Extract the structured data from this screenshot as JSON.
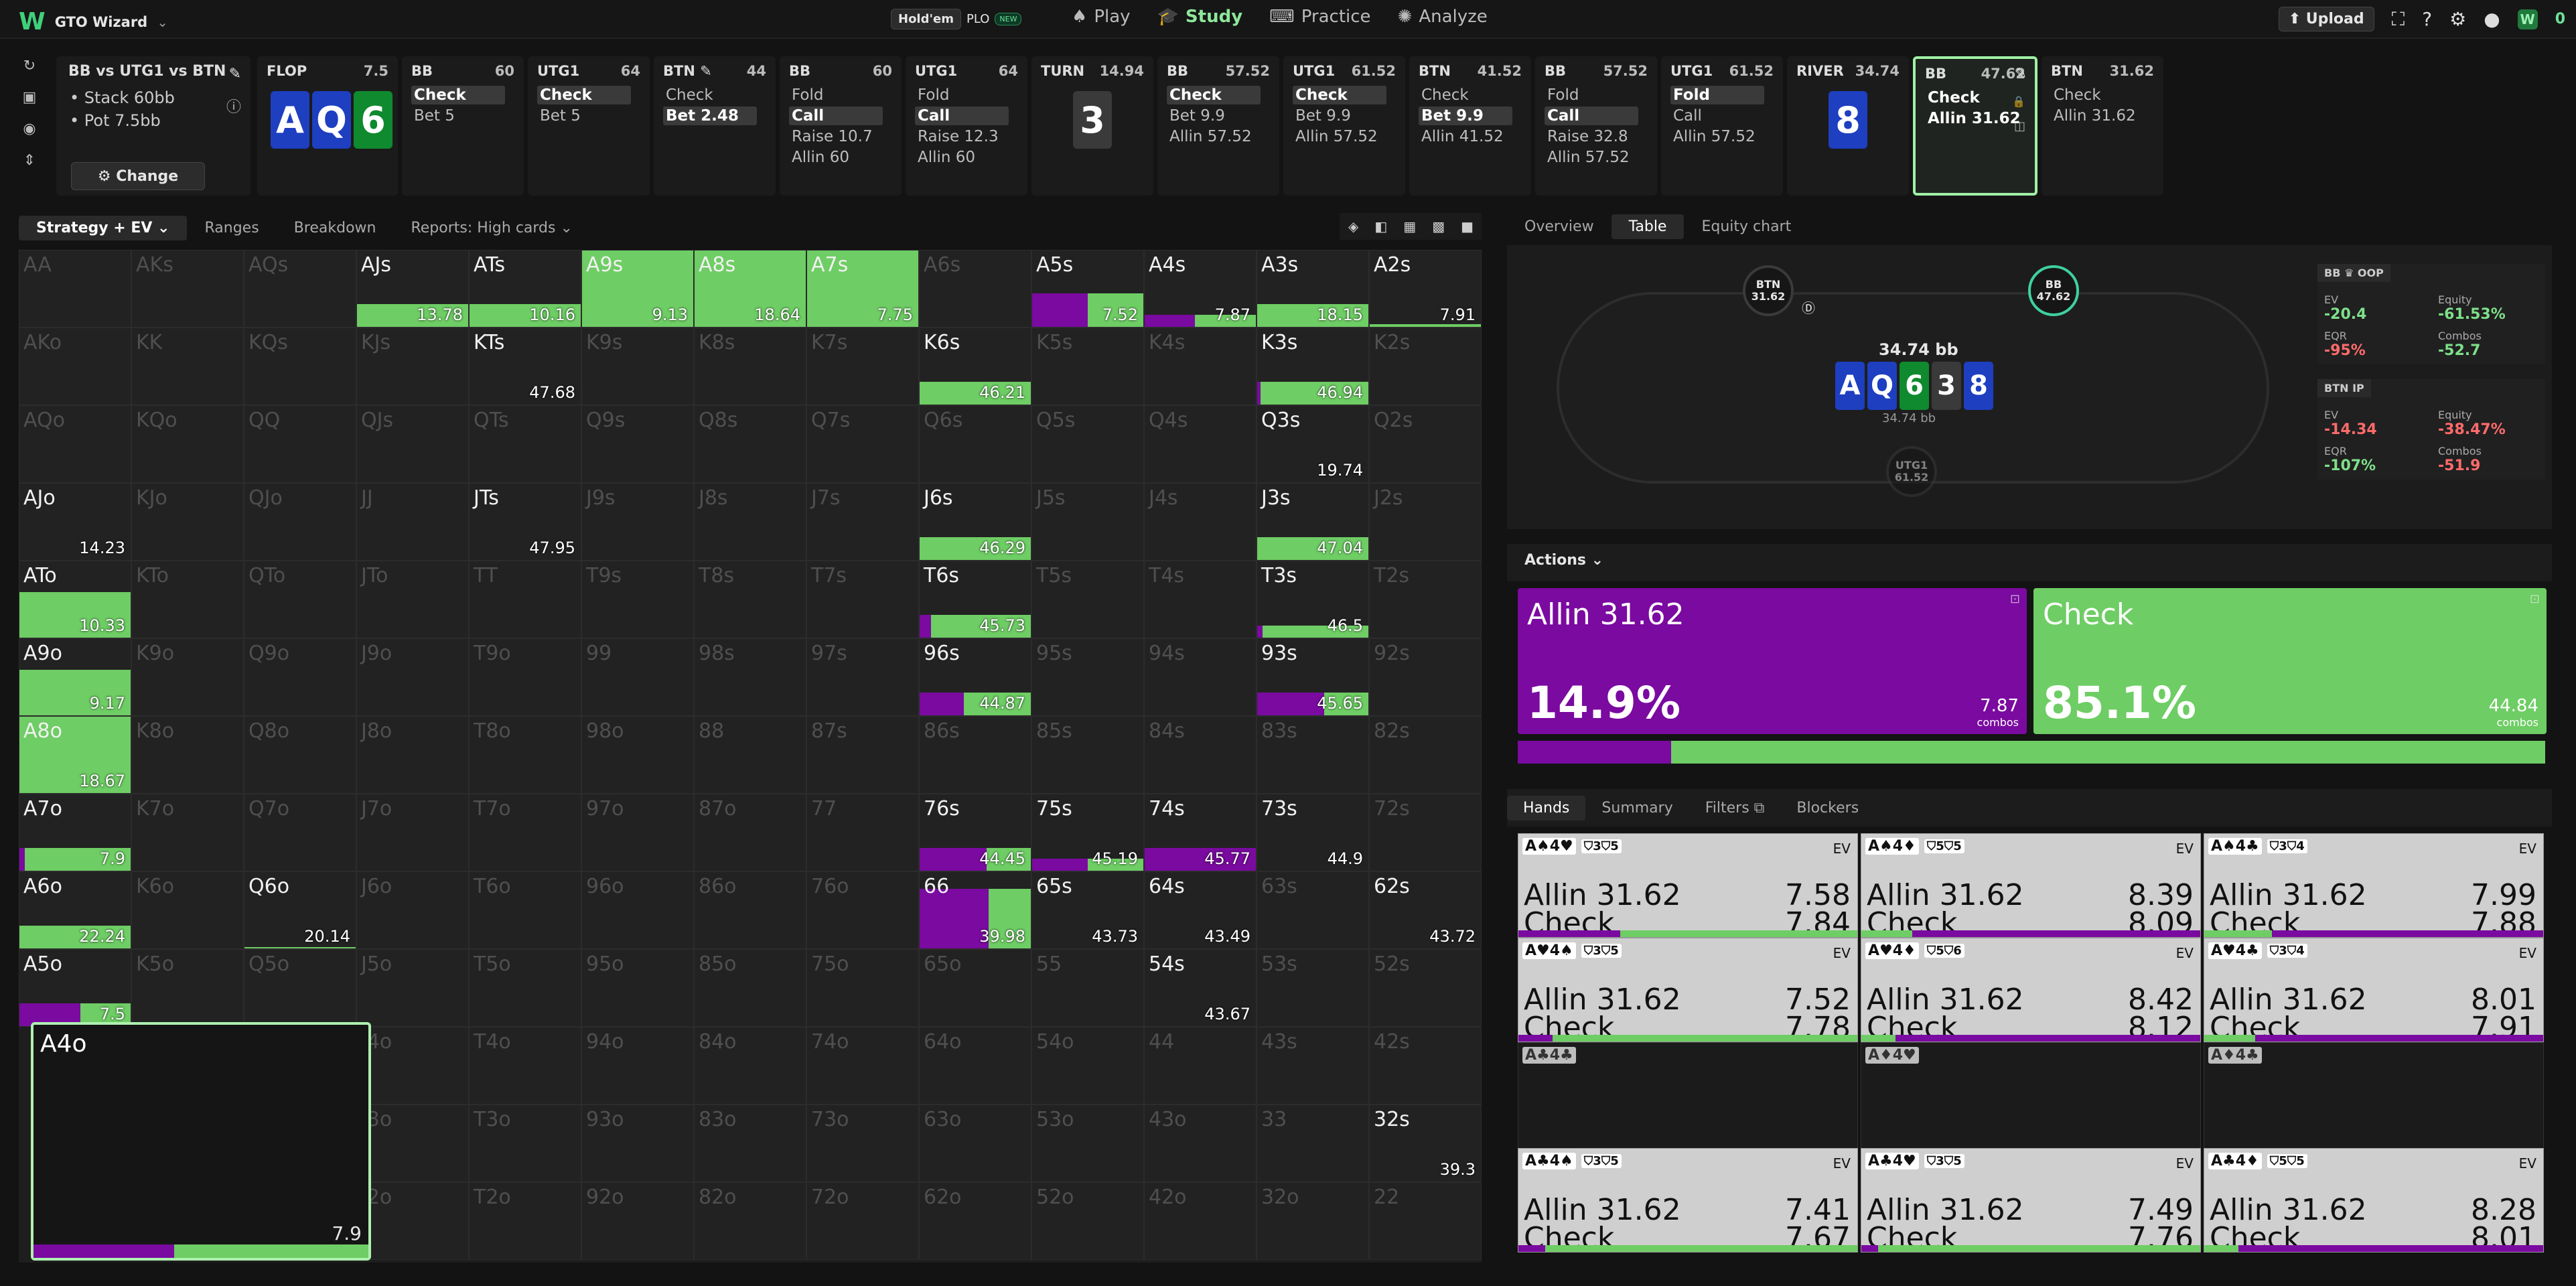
{
  "app": {
    "logo": "W",
    "name": "GTO Wizard",
    "chevron": "⌄"
  },
  "modes": {
    "holdem": "Hold'em",
    "plo": "PLO",
    "new_badge": "NEW"
  },
  "nav": [
    {
      "label": "Play",
      "icon": "cards-icon"
    },
    {
      "label": "Study",
      "icon": "graduation-icon"
    },
    {
      "label": "Practice",
      "icon": "gamepad-icon"
    },
    {
      "label": "Analyze",
      "icon": "bulb-icon"
    }
  ],
  "topright": {
    "upload": "⬆ Upload",
    "credits": "0"
  },
  "spot": {
    "title": "BB vs UTG1 vs BTN",
    "stack": "• Stack 60bb",
    "pot": "• Pot 7.5bb",
    "change": "⚙ Change"
  },
  "nodes": [
    {
      "h": "FLOP",
      "s": "7.5",
      "cards": [
        [
          "A",
          "d"
        ],
        [
          "Q",
          "d"
        ],
        [
          "6",
          "c"
        ]
      ]
    },
    {
      "h": "BB",
      "s": "60",
      "acts": [
        "Check",
        "Bet 5"
      ],
      "sel": 0
    },
    {
      "h": "UTG1",
      "s": "64",
      "acts": [
        "Check",
        "Bet 5"
      ],
      "sel": 0
    },
    {
      "h": "BTN ✎",
      "s": "44",
      "acts": [
        "Check",
        "Bet 2.48"
      ],
      "sel": 1
    },
    {
      "h": "BB",
      "s": "60",
      "acts": [
        "Fold",
        "Call",
        "Raise 10.7",
        "Allin 60"
      ],
      "sel": 1
    },
    {
      "h": "UTG1",
      "s": "64",
      "acts": [
        "Fold",
        "Call",
        "Raise 12.3",
        "Allin 60"
      ],
      "sel": 1
    },
    {
      "h": "TURN",
      "s": "14.94",
      "cards": [
        [
          "3",
          "x"
        ]
      ]
    },
    {
      "h": "BB",
      "s": "57.52",
      "acts": [
        "Check",
        "Bet 9.9",
        "Allin 57.52"
      ],
      "sel": 0
    },
    {
      "h": "UTG1",
      "s": "61.52",
      "acts": [
        "Check",
        "Bet 9.9",
        "Allin 57.52"
      ],
      "sel": 0
    },
    {
      "h": "BTN",
      "s": "41.52",
      "acts": [
        "Check",
        "Bet 9.9",
        "Allin 41.52"
      ],
      "sel": 1
    },
    {
      "h": "BB",
      "s": "57.52",
      "acts": [
        "Fold",
        "Call",
        "Raise 32.8",
        "Allin 57.52"
      ],
      "sel": 1
    },
    {
      "h": "UTG1",
      "s": "61.52",
      "acts": [
        "Fold",
        "Call",
        "Allin 57.52"
      ],
      "sel": 0
    },
    {
      "h": "RIVER",
      "s": "34.74",
      "cards": [
        [
          "8",
          "d"
        ]
      ]
    },
    {
      "h": "BB",
      "s": "47.62",
      "acts": [
        "Check",
        "Allin 31.62"
      ],
      "sel": -1,
      "cur": true
    },
    {
      "h": "BTN",
      "s": "31.62",
      "acts": [
        "Check",
        "Allin 31.62"
      ],
      "sel": -1
    }
  ],
  "grid_tabs": [
    "Strategy + EV ⌄",
    "Ranges",
    "Breakdown",
    "Reports: High cards ⌄"
  ],
  "grid": {
    "names": [
      [
        "AA",
        "AKs",
        "AQs",
        "AJs",
        "ATs",
        "A9s",
        "A8s",
        "A7s",
        "A6s",
        "A5s",
        "A4s",
        "A3s",
        "A2s"
      ],
      [
        "AKo",
        "KK",
        "KQs",
        "KJs",
        "KTs",
        "K9s",
        "K8s",
        "K7s",
        "K6s",
        "K5s",
        "K4s",
        "K3s",
        "K2s"
      ],
      [
        "AQo",
        "KQo",
        "QQ",
        "QJs",
        "QTs",
        "Q9s",
        "Q8s",
        "Q7s",
        "Q6s",
        "Q5s",
        "Q4s",
        "Q3s",
        "Q2s"
      ],
      [
        "AJo",
        "KJo",
        "QJo",
        "JJ",
        "JTs",
        "J9s",
        "J8s",
        "J7s",
        "J6s",
        "J5s",
        "J4s",
        "J3s",
        "J2s"
      ],
      [
        "ATo",
        "KTo",
        "QTo",
        "JTo",
        "TT",
        "T9s",
        "T8s",
        "T7s",
        "T6s",
        "T5s",
        "T4s",
        "T3s",
        "T2s"
      ],
      [
        "A9o",
        "K9o",
        "Q9o",
        "J9o",
        "T9o",
        "99",
        "98s",
        "97s",
        "96s",
        "95s",
        "94s",
        "93s",
        "92s"
      ],
      [
        "A8o",
        "K8o",
        "Q8o",
        "J8o",
        "T8o",
        "98o",
        "88",
        "87s",
        "86s",
        "85s",
        "84s",
        "83s",
        "82s"
      ],
      [
        "A7o",
        "K7o",
        "Q7o",
        "J7o",
        "T7o",
        "97o",
        "87o",
        "77",
        "76s",
        "75s",
        "74s",
        "73s",
        "72s"
      ],
      [
        "A6o",
        "K6o",
        "Q6o",
        "J6o",
        "T6o",
        "96o",
        "86o",
        "76o",
        "66",
        "65s",
        "64s",
        "63s",
        "62s"
      ],
      [
        "A5o",
        "K5o",
        "Q5o",
        "J5o",
        "T5o",
        "95o",
        "85o",
        "75o",
        "65o",
        "55",
        "54s",
        "53s",
        "52s"
      ],
      [
        "A4o",
        "K4o",
        "Q4o",
        "J4o",
        "T4o",
        "94o",
        "84o",
        "74o",
        "64o",
        "54o",
        "44",
        "43s",
        "42s"
      ],
      [
        "A3o",
        "K3o",
        "Q3o",
        "J3o",
        "T3o",
        "93o",
        "83o",
        "73o",
        "63o",
        "53o",
        "43o",
        "33",
        "32s"
      ],
      [
        "A2o",
        "K2o",
        "Q2o",
        "J2o",
        "T2o",
        "92o",
        "82o",
        "72o",
        "62o",
        "52o",
        "42o",
        "32o",
        "22"
      ]
    ],
    "cells": [
      {
        "r": 0,
        "c": 3,
        "v": "13.78",
        "g": 1,
        "p": 0
      },
      {
        "r": 0,
        "c": 4,
        "v": "10.16",
        "g": 1,
        "p": 0
      },
      {
        "r": 0,
        "c": 5,
        "v": "9.13",
        "full": 1
      },
      {
        "r": 0,
        "c": 6,
        "v": "18.64",
        "full": 1
      },
      {
        "r": 0,
        "c": 7,
        "v": "7.75",
        "full": 1
      },
      {
        "r": 0,
        "c": 9,
        "v": "7.52",
        "g": 0.5,
        "p": 0.5,
        "tall": 1
      },
      {
        "r": 0,
        "c": 10,
        "v": "7.87",
        "g": 0.55,
        "p": 0.45,
        "short": 1
      },
      {
        "r": 0,
        "c": 11,
        "v": "18.15",
        "g": 1,
        "p": 0
      },
      {
        "r": 0,
        "c": 12,
        "v": "7.91",
        "g": 1,
        "p": 0,
        "thin": 1
      },
      {
        "r": 1,
        "c": 4,
        "v": "47.68",
        "g": 0,
        "p": 0
      },
      {
        "r": 1,
        "c": 8,
        "v": "46.21",
        "g": 1,
        "p": 0
      },
      {
        "r": 1,
        "c": 11,
        "v": "46.94",
        "g": 0.97,
        "p": 0.03
      },
      {
        "r": 2,
        "c": 11,
        "v": "19.74",
        "g": 0,
        "p": 0
      },
      {
        "r": 3,
        "c": 0,
        "v": "14.23",
        "g": 0,
        "p": 0
      },
      {
        "r": 3,
        "c": 4,
        "v": "47.95",
        "g": 0,
        "p": 0
      },
      {
        "r": 3,
        "c": 8,
        "v": "46.29",
        "g": 1,
        "p": 0
      },
      {
        "r": 3,
        "c": 11,
        "v": "47.04",
        "g": 1,
        "p": 0
      },
      {
        "r": 4,
        "c": 0,
        "v": "10.33",
        "full": 1,
        "half": 1
      },
      {
        "r": 4,
        "c": 8,
        "v": "45.73",
        "g": 0.9,
        "p": 0.1
      },
      {
        "r": 4,
        "c": 11,
        "v": "46.5",
        "g": 0.95,
        "p": 0.05,
        "short": 1
      },
      {
        "r": 5,
        "c": 0,
        "v": "9.17",
        "full": 1,
        "half": 1
      },
      {
        "r": 5,
        "c": 8,
        "v": "44.87",
        "g": 0.6,
        "p": 0.4
      },
      {
        "r": 5,
        "c": 11,
        "v": "45.65",
        "g": 0.4,
        "p": 0.6
      },
      {
        "r": 6,
        "c": 0,
        "v": "18.67",
        "full": 1
      },
      {
        "r": 7,
        "c": 0,
        "v": "7.9",
        "g": 0.95,
        "p": 0.05
      },
      {
        "r": 7,
        "c": 8,
        "v": "44.45",
        "g": 0.4,
        "p": 0.6
      },
      {
        "r": 7,
        "c": 9,
        "v": "45.19",
        "g": 0.5,
        "p": 0.5,
        "short": 1
      },
      {
        "r": 7,
        "c": 10,
        "v": "45.77",
        "g": 0,
        "p": 1
      },
      {
        "r": 7,
        "c": 11,
        "v": "44.9",
        "g": 0,
        "p": 0
      },
      {
        "r": 8,
        "c": 0,
        "v": "22.24",
        "g": 1,
        "p": 0
      },
      {
        "r": 8,
        "c": 2,
        "v": "20.14",
        "g": 0,
        "p": 0,
        "line": 1
      },
      {
        "r": 8,
        "c": 8,
        "v": "39.98",
        "pg": 1
      },
      {
        "r": 8,
        "c": 9,
        "v": "43.73",
        "g": 0,
        "p": 0
      },
      {
        "r": 8,
        "c": 10,
        "v": "43.49",
        "g": 0,
        "p": 0
      },
      {
        "r": 8,
        "c": 12,
        "v": "43.72",
        "g": 0,
        "p": 0
      },
      {
        "r": 9,
        "c": 0,
        "v": "7.5",
        "g": 0.45,
        "p": 0.55
      },
      {
        "r": 9,
        "c": 10,
        "v": "43.67",
        "g": 0,
        "p": 0
      },
      {
        "r": 11,
        "c": 12,
        "v": "39.3",
        "g": 0,
        "p": 0
      }
    ],
    "active": [
      "AJs",
      "ATs",
      "A9s",
      "A8s",
      "A7s",
      "A5s",
      "A4s",
      "A3s",
      "A2s",
      "KTs",
      "K6s",
      "K3s",
      "Q3s",
      "AJo",
      "JTs",
      "J6s",
      "J3s",
      "ATo",
      "T6s",
      "T3s",
      "A9o",
      "96s",
      "93s",
      "A8o",
      "A7o",
      "76s",
      "75s",
      "74s",
      "73s",
      "A6o",
      "Q6o",
      "66",
      "65s",
      "64s",
      "62s",
      "A5o",
      "54s",
      "32s"
    ],
    "selected": {
      "name": "A4o",
      "value": "7.9"
    }
  },
  "right_tabs": [
    "Overview",
    "Table",
    "Equity chart"
  ],
  "table": {
    "pot": "34.74 bb",
    "pot_small": "34.74 bb",
    "seats": [
      {
        "n": "BTN",
        "v": "31.62"
      },
      {
        "n": "BB",
        "v": "47.62"
      },
      {
        "n": "UTG1",
        "v": "61.52"
      }
    ],
    "board": [
      [
        "A",
        "d"
      ],
      [
        "Q",
        "d"
      ],
      [
        "6",
        "c"
      ],
      [
        "3",
        "x"
      ],
      [
        "8",
        "d"
      ]
    ],
    "stats": [
      {
        "hd": "BB ♛ OOP",
        "ev": "-20.4",
        "eq": "-61.53%",
        "eqr": "-95%",
        "combos": "-52.7"
      },
      {
        "hd": "BTN IP",
        "ev": "-14.34",
        "eq": "-38.47%",
        "eqr": "-107%",
        "combos": "-51.9"
      }
    ],
    "labels": {
      "ev": "EV",
      "equity": "Equity",
      "eqr": "EQR",
      "combos": "Combos"
    }
  },
  "actions_label": "Actions ⌄",
  "actions": [
    {
      "label": "Allin 31.62",
      "pct": "14.9%",
      "combos": "7.87",
      "color": "#7a0aa0",
      "share": 0.149
    },
    {
      "label": "Check",
      "pct": "85.1%",
      "combos": "44.84",
      "color": "#6ecd64",
      "share": 0.851
    }
  ],
  "combos_word": "combos",
  "hand_tabs": [
    "Hands",
    "Summary",
    "Filters ⧉",
    "Blockers"
  ],
  "hands": [
    {
      "combo": "A♠4♥",
      "bl": "⛉3⛉5",
      "allin": "7.58",
      "check": "7.84",
      "p": 0.3
    },
    {
      "combo": "A♠4♦",
      "bl": "⛉5⛉5",
      "allin": "8.39",
      "check": "8.09",
      "p": 0.85
    },
    {
      "combo": "A♠4♣",
      "bl": "⛉3⛉4",
      "allin": "7.99",
      "check": "7.88",
      "p": 0.8
    },
    {
      "combo": "A♥4♠",
      "bl": "⛉3⛉5",
      "allin": "7.52",
      "check": "7.78",
      "p": 0.1
    },
    {
      "combo": "A♥4♦",
      "bl": "⛉5⛉6",
      "allin": "8.42",
      "check": "8.12",
      "p": 0.9
    },
    {
      "combo": "A♥4♣",
      "bl": "⛉3⛉4",
      "allin": "8.01",
      "check": "7.91",
      "p": 0.85
    },
    {
      "combo": "A♣4♣",
      "empty": 1
    },
    {
      "combo": "A♦4♥",
      "empty": 1
    },
    {
      "combo": "A♦4♣",
      "empty": 1
    },
    {
      "combo": "A♣4♠",
      "bl": "⛉3⛉5",
      "allin": "7.41",
      "check": "7.67",
      "p": 0.08
    },
    {
      "combo": "A♣4♥",
      "bl": "⛉3⛉5",
      "allin": "7.49",
      "check": "7.76",
      "p": 0.05
    },
    {
      "combo": "A♣4♦",
      "bl": "⛉5⛉5",
      "allin": "8.28",
      "check": "8.01",
      "p": 0.9
    }
  ],
  "ev_label": "EV",
  "allin_label": "Allin 31.62",
  "check_label": "Check"
}
